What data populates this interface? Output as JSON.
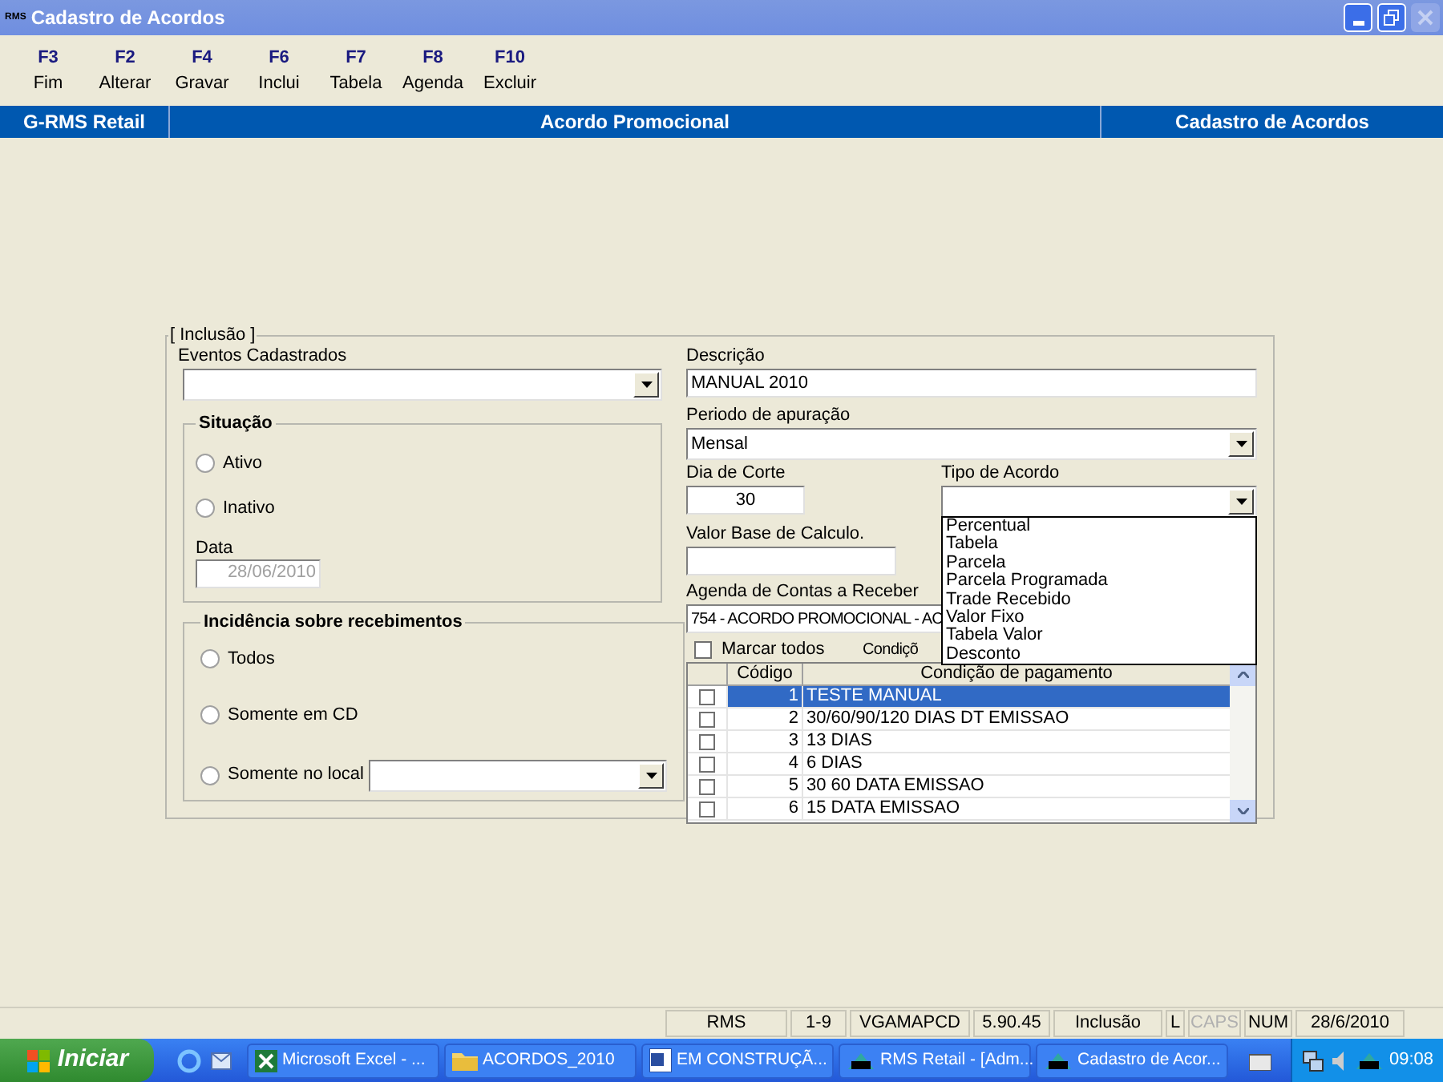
{
  "window": {
    "title": "Cadastro de Acordos",
    "app_mark": "RMS"
  },
  "toolbar": [
    {
      "key": "F3",
      "label": "Fim"
    },
    {
      "key": "F2",
      "label": "Alterar"
    },
    {
      "key": "F4",
      "label": "Gravar"
    },
    {
      "key": "F6",
      "label": "Inclui"
    },
    {
      "key": "F7",
      "label": "Tabela"
    },
    {
      "key": "F8",
      "label": "Agenda"
    },
    {
      "key": "F10",
      "label": "Excluir"
    }
  ],
  "header_bar": [
    "G-RMS Retail",
    "Acordo Promocional",
    "Cadastro de Acordos"
  ],
  "form": {
    "group_title": "[ Inclusão ]",
    "eventos": {
      "label": "Eventos Cadastrados"
    },
    "situacao": {
      "title": "Situação",
      "options": [
        {
          "label": "Ativo",
          "selected": false
        },
        {
          "label": "Inativo",
          "selected": false
        }
      ],
      "data_label": "Data",
      "data_value": "28/06/2010"
    },
    "incidencia": {
      "title": "Incidência sobre recebimentos",
      "options": [
        {
          "label": "Todos",
          "selected": false
        },
        {
          "label": "Somente em CD",
          "selected": false
        },
        {
          "label": "Somente no local",
          "selected": false,
          "kind": "with-combo"
        }
      ]
    },
    "descricao": {
      "label": "Descrição",
      "value": "MANUAL 2010"
    },
    "periodo": {
      "label": "Periodo de apuração",
      "value": "Mensal"
    },
    "dia_corte": {
      "label": "Dia de Corte",
      "value": "30"
    },
    "tipo_acordo": {
      "label": "Tipo de Acordo",
      "expanded": true,
      "options": [
        "Percentual",
        "Tabela",
        "Parcela",
        "Parcela Programada",
        "Trade Recebido",
        "Valor Fixo",
        "Tabela Valor",
        "Desconto"
      ]
    },
    "valor_base": {
      "label": "Valor Base de Calculo."
    },
    "agenda": {
      "label": "Agenda de Contas a Receber",
      "value": "754 - ACORDO PROMOCIONAL - AC"
    },
    "marcar_todos": {
      "label": "Marcar todos",
      "checked": false
    },
    "condicoes_label": "Condiçõ",
    "table": {
      "columns": [
        "Código",
        "Condição de pagamento"
      ],
      "rows": [
        {
          "code": "1",
          "name": "TESTE MANUAL",
          "checked": false,
          "selected": true
        },
        {
          "code": "2",
          "name": "30/60/90/120 DIAS DT EMISSAO",
          "checked": false,
          "selected": false
        },
        {
          "code": "3",
          "name": "13 DIAS",
          "checked": false,
          "selected": false
        },
        {
          "code": "4",
          "name": "6 DIAS",
          "checked": false,
          "selected": false
        },
        {
          "code": "5",
          "name": "30 60 DATA EMISSAO",
          "checked": false,
          "selected": false
        },
        {
          "code": "6",
          "name": "15 DATA EMISSAO",
          "checked": false,
          "selected": false
        }
      ]
    }
  },
  "status_bar": [
    {
      "text": "RMS",
      "disabled": false
    },
    {
      "text": "1-9",
      "disabled": false
    },
    {
      "text": "VGAMAPCD",
      "disabled": false
    },
    {
      "text": "5.90.45",
      "disabled": false
    },
    {
      "text": "Inclusão",
      "disabled": false
    },
    {
      "text": "L",
      "disabled": false
    },
    {
      "text": "CAPS",
      "disabled": true
    },
    {
      "text": "NUM",
      "disabled": false
    },
    {
      "text": "28/6/2010",
      "disabled": false
    }
  ],
  "taskbar": {
    "start": "Iniciar",
    "items": [
      {
        "label": "Microsoft Excel - ...",
        "kind": "excel"
      },
      {
        "label": "ACORDOS_2010",
        "kind": "folder"
      },
      {
        "label": "EM CONSTRUÇÃ...",
        "kind": "word"
      },
      {
        "label": "RMS Retail - [Adm...",
        "kind": "rms"
      },
      {
        "label": "Cadastro de Acor...",
        "kind": "rms"
      }
    ],
    "clock": "09:08"
  }
}
